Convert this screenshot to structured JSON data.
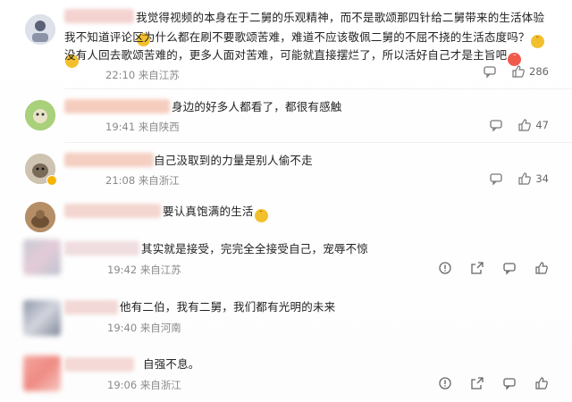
{
  "comments": [
    {
      "text_1": "我觉得视频的本身在于二舅的乐观精神，而不是歌颂那四针给二舅带来的生活体验",
      "text_2": "我不知道评论区为什么都在刷不要歌颂苦难，难道不应该敬佩二舅的不屈不挠的生活态度吗？",
      "text_3": "没有人回去歌颂苦难的，更多人面对苦难，可能就直接摆烂了，所以活好自己才是主旨吧",
      "time": "22:10",
      "location": "来自江苏",
      "like_count": "286"
    },
    {
      "text": "身边的好多人都看了，都很有感触",
      "time": "19:41",
      "location": "来自陕西",
      "like_count": "47"
    },
    {
      "text": "自己汲取到的力量是别人偷不走",
      "time": "21:08",
      "location": "来自浙江",
      "like_count": "34"
    },
    {
      "text": "要认真饱满的生活"
    },
    {
      "text": "其实就是接受，完完全全接受自己，宠辱不惊",
      "time": "19:42",
      "location": "来自江苏"
    },
    {
      "text": "他有二伯，我有二舅，我们都有光明的未来",
      "time": "19:40",
      "location": "来自河南"
    },
    {
      "text": "自强不息。",
      "time": "19:06",
      "location": "来自浙江"
    }
  ],
  "icons": {
    "reply": "comment-icon",
    "like": "thumbs-up-icon",
    "share": "share-icon",
    "report": "report-icon"
  },
  "colors": {
    "meta_gray": "#8a8a8a",
    "emoji_yellow": "#f3c02d"
  }
}
